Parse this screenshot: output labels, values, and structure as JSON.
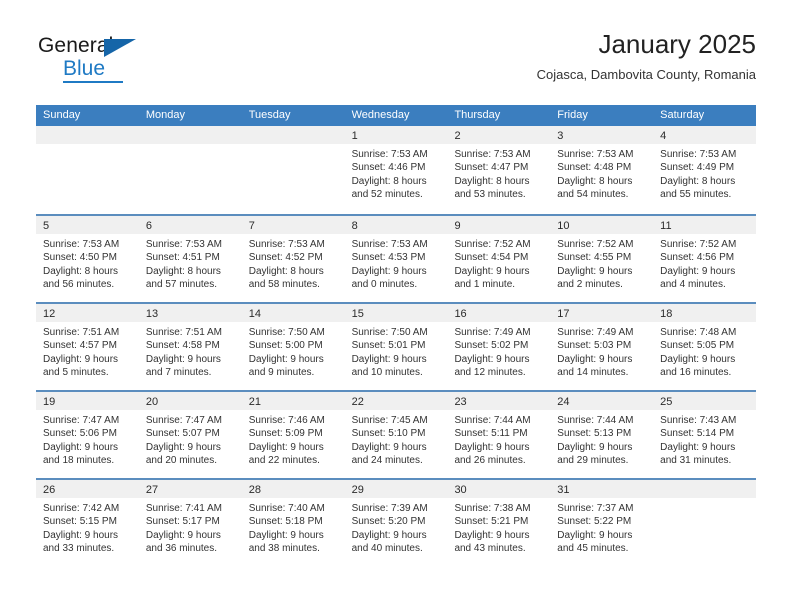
{
  "brand": {
    "name_primary": "General",
    "name_secondary": "Blue",
    "accent_color": "#1f7ac4",
    "triangle_color": "#1565a8"
  },
  "header": {
    "title": "January 2025",
    "subtitle": "Cojasca, Dambovita County, Romania"
  },
  "calendar": {
    "header_bg": "#3b7ebf",
    "header_text_color": "#ffffff",
    "daynum_bg": "#f0f0f0",
    "weekdays": [
      "Sunday",
      "Monday",
      "Tuesday",
      "Wednesday",
      "Thursday",
      "Friday",
      "Saturday"
    ],
    "weeks": [
      [
        {
          "day": "",
          "sunrise": "",
          "sunset": "",
          "daylight_line1": "",
          "daylight_line2": ""
        },
        {
          "day": "",
          "sunrise": "",
          "sunset": "",
          "daylight_line1": "",
          "daylight_line2": ""
        },
        {
          "day": "",
          "sunrise": "",
          "sunset": "",
          "daylight_line1": "",
          "daylight_line2": ""
        },
        {
          "day": "1",
          "sunrise": "Sunrise: 7:53 AM",
          "sunset": "Sunset: 4:46 PM",
          "daylight_line1": "Daylight: 8 hours",
          "daylight_line2": "and 52 minutes."
        },
        {
          "day": "2",
          "sunrise": "Sunrise: 7:53 AM",
          "sunset": "Sunset: 4:47 PM",
          "daylight_line1": "Daylight: 8 hours",
          "daylight_line2": "and 53 minutes."
        },
        {
          "day": "3",
          "sunrise": "Sunrise: 7:53 AM",
          "sunset": "Sunset: 4:48 PM",
          "daylight_line1": "Daylight: 8 hours",
          "daylight_line2": "and 54 minutes."
        },
        {
          "day": "4",
          "sunrise": "Sunrise: 7:53 AM",
          "sunset": "Sunset: 4:49 PM",
          "daylight_line1": "Daylight: 8 hours",
          "daylight_line2": "and 55 minutes."
        }
      ],
      [
        {
          "day": "5",
          "sunrise": "Sunrise: 7:53 AM",
          "sunset": "Sunset: 4:50 PM",
          "daylight_line1": "Daylight: 8 hours",
          "daylight_line2": "and 56 minutes."
        },
        {
          "day": "6",
          "sunrise": "Sunrise: 7:53 AM",
          "sunset": "Sunset: 4:51 PM",
          "daylight_line1": "Daylight: 8 hours",
          "daylight_line2": "and 57 minutes."
        },
        {
          "day": "7",
          "sunrise": "Sunrise: 7:53 AM",
          "sunset": "Sunset: 4:52 PM",
          "daylight_line1": "Daylight: 8 hours",
          "daylight_line2": "and 58 minutes."
        },
        {
          "day": "8",
          "sunrise": "Sunrise: 7:53 AM",
          "sunset": "Sunset: 4:53 PM",
          "daylight_line1": "Daylight: 9 hours",
          "daylight_line2": "and 0 minutes."
        },
        {
          "day": "9",
          "sunrise": "Sunrise: 7:52 AM",
          "sunset": "Sunset: 4:54 PM",
          "daylight_line1": "Daylight: 9 hours",
          "daylight_line2": "and 1 minute."
        },
        {
          "day": "10",
          "sunrise": "Sunrise: 7:52 AM",
          "sunset": "Sunset: 4:55 PM",
          "daylight_line1": "Daylight: 9 hours",
          "daylight_line2": "and 2 minutes."
        },
        {
          "day": "11",
          "sunrise": "Sunrise: 7:52 AM",
          "sunset": "Sunset: 4:56 PM",
          "daylight_line1": "Daylight: 9 hours",
          "daylight_line2": "and 4 minutes."
        }
      ],
      [
        {
          "day": "12",
          "sunrise": "Sunrise: 7:51 AM",
          "sunset": "Sunset: 4:57 PM",
          "daylight_line1": "Daylight: 9 hours",
          "daylight_line2": "and 5 minutes."
        },
        {
          "day": "13",
          "sunrise": "Sunrise: 7:51 AM",
          "sunset": "Sunset: 4:58 PM",
          "daylight_line1": "Daylight: 9 hours",
          "daylight_line2": "and 7 minutes."
        },
        {
          "day": "14",
          "sunrise": "Sunrise: 7:50 AM",
          "sunset": "Sunset: 5:00 PM",
          "daylight_line1": "Daylight: 9 hours",
          "daylight_line2": "and 9 minutes."
        },
        {
          "day": "15",
          "sunrise": "Sunrise: 7:50 AM",
          "sunset": "Sunset: 5:01 PM",
          "daylight_line1": "Daylight: 9 hours",
          "daylight_line2": "and 10 minutes."
        },
        {
          "day": "16",
          "sunrise": "Sunrise: 7:49 AM",
          "sunset": "Sunset: 5:02 PM",
          "daylight_line1": "Daylight: 9 hours",
          "daylight_line2": "and 12 minutes."
        },
        {
          "day": "17",
          "sunrise": "Sunrise: 7:49 AM",
          "sunset": "Sunset: 5:03 PM",
          "daylight_line1": "Daylight: 9 hours",
          "daylight_line2": "and 14 minutes."
        },
        {
          "day": "18",
          "sunrise": "Sunrise: 7:48 AM",
          "sunset": "Sunset: 5:05 PM",
          "daylight_line1": "Daylight: 9 hours",
          "daylight_line2": "and 16 minutes."
        }
      ],
      [
        {
          "day": "19",
          "sunrise": "Sunrise: 7:47 AM",
          "sunset": "Sunset: 5:06 PM",
          "daylight_line1": "Daylight: 9 hours",
          "daylight_line2": "and 18 minutes."
        },
        {
          "day": "20",
          "sunrise": "Sunrise: 7:47 AM",
          "sunset": "Sunset: 5:07 PM",
          "daylight_line1": "Daylight: 9 hours",
          "daylight_line2": "and 20 minutes."
        },
        {
          "day": "21",
          "sunrise": "Sunrise: 7:46 AM",
          "sunset": "Sunset: 5:09 PM",
          "daylight_line1": "Daylight: 9 hours",
          "daylight_line2": "and 22 minutes."
        },
        {
          "day": "22",
          "sunrise": "Sunrise: 7:45 AM",
          "sunset": "Sunset: 5:10 PM",
          "daylight_line1": "Daylight: 9 hours",
          "daylight_line2": "and 24 minutes."
        },
        {
          "day": "23",
          "sunrise": "Sunrise: 7:44 AM",
          "sunset": "Sunset: 5:11 PM",
          "daylight_line1": "Daylight: 9 hours",
          "daylight_line2": "and 26 minutes."
        },
        {
          "day": "24",
          "sunrise": "Sunrise: 7:44 AM",
          "sunset": "Sunset: 5:13 PM",
          "daylight_line1": "Daylight: 9 hours",
          "daylight_line2": "and 29 minutes."
        },
        {
          "day": "25",
          "sunrise": "Sunrise: 7:43 AM",
          "sunset": "Sunset: 5:14 PM",
          "daylight_line1": "Daylight: 9 hours",
          "daylight_line2": "and 31 minutes."
        }
      ],
      [
        {
          "day": "26",
          "sunrise": "Sunrise: 7:42 AM",
          "sunset": "Sunset: 5:15 PM",
          "daylight_line1": "Daylight: 9 hours",
          "daylight_line2": "and 33 minutes."
        },
        {
          "day": "27",
          "sunrise": "Sunrise: 7:41 AM",
          "sunset": "Sunset: 5:17 PM",
          "daylight_line1": "Daylight: 9 hours",
          "daylight_line2": "and 36 minutes."
        },
        {
          "day": "28",
          "sunrise": "Sunrise: 7:40 AM",
          "sunset": "Sunset: 5:18 PM",
          "daylight_line1": "Daylight: 9 hours",
          "daylight_line2": "and 38 minutes."
        },
        {
          "day": "29",
          "sunrise": "Sunrise: 7:39 AM",
          "sunset": "Sunset: 5:20 PM",
          "daylight_line1": "Daylight: 9 hours",
          "daylight_line2": "and 40 minutes."
        },
        {
          "day": "30",
          "sunrise": "Sunrise: 7:38 AM",
          "sunset": "Sunset: 5:21 PM",
          "daylight_line1": "Daylight: 9 hours",
          "daylight_line2": "and 43 minutes."
        },
        {
          "day": "31",
          "sunrise": "Sunrise: 7:37 AM",
          "sunset": "Sunset: 5:22 PM",
          "daylight_line1": "Daylight: 9 hours",
          "daylight_line2": "and 45 minutes."
        },
        {
          "day": "",
          "sunrise": "",
          "sunset": "",
          "daylight_line1": "",
          "daylight_line2": ""
        }
      ]
    ]
  }
}
